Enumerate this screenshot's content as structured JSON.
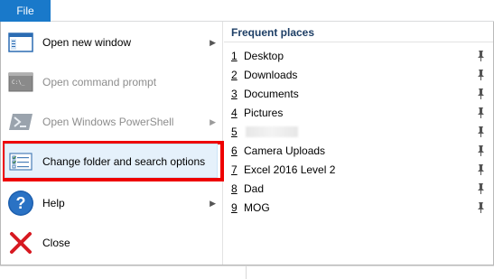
{
  "ribbon": {
    "file_tab": "File"
  },
  "menu": {
    "open_new_window": {
      "label": "Open new window",
      "mnemonic_index": 5
    },
    "open_command_prompt": {
      "label": "Open command prompt"
    },
    "open_powershell": {
      "label": "Open Windows PowerShell"
    },
    "change_folder_options": {
      "label": "Change folder and search options"
    },
    "help": {
      "label": "Help"
    },
    "close": {
      "label": "Close"
    }
  },
  "frequent_places": {
    "title": "Frequent places",
    "items": [
      {
        "num": "1",
        "name": "Desktop"
      },
      {
        "num": "2",
        "name": "Downloads"
      },
      {
        "num": "3",
        "name": "Documents"
      },
      {
        "num": "4",
        "name": "Pictures"
      },
      {
        "num": "5",
        "name": ""
      },
      {
        "num": "6",
        "name": "Camera Uploads"
      },
      {
        "num": "7",
        "name": "Excel 2016 Level 2"
      },
      {
        "num": "8",
        "name": "Dad"
      },
      {
        "num": "9",
        "name": "MOG"
      }
    ]
  },
  "colors": {
    "file_tab": "#1979ca",
    "highlight_border": "#ee0000",
    "frequent_title": "#1e3f66"
  }
}
